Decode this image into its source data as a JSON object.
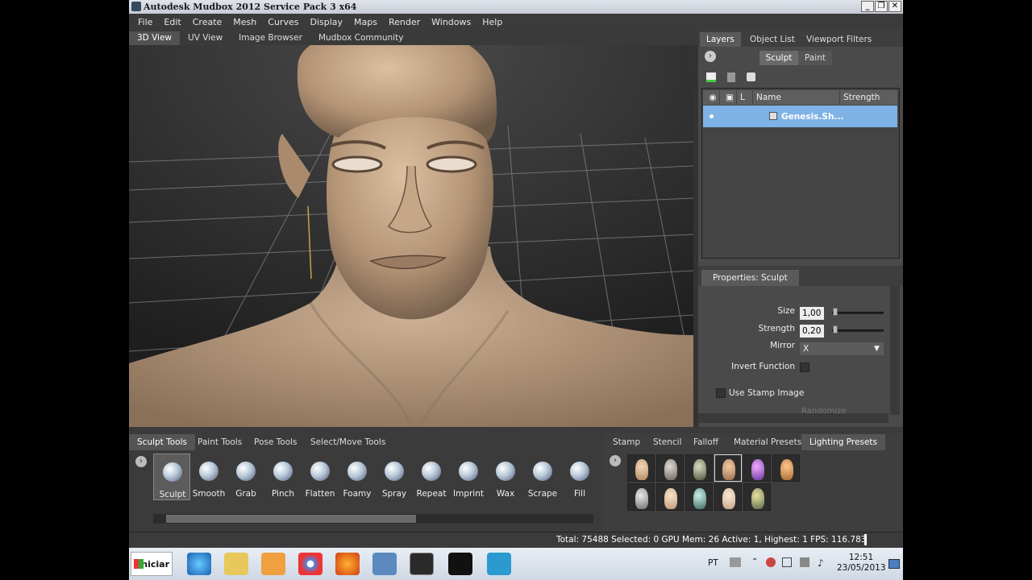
{
  "window": {
    "title": "Autodesk Mudbox 2012 Service Pack 3 x64",
    "min": "_",
    "max": "❐",
    "close": "✕"
  },
  "menu": [
    "File",
    "Edit",
    "Create",
    "Mesh",
    "Curves",
    "Display",
    "Maps",
    "Render",
    "Windows",
    "Help"
  ],
  "viewport_tabs": [
    "3D View",
    "UV View",
    "Image Browser",
    "Mudbox Community"
  ],
  "right_tabs": [
    "Layers",
    "Object List",
    "Viewport Filters"
  ],
  "layers": {
    "mode_sculpt": "Sculpt",
    "mode_paint": "Paint",
    "col_l": "L",
    "col_name": "Name",
    "col_strength": "Strength",
    "row_name": "Genesis.Sh..."
  },
  "properties": {
    "tab": "Properties: Sculpt",
    "size_label": "Size",
    "size_value": "1,00",
    "strength_label": "Strength",
    "strength_value": "0,20",
    "mirror_label": "Mirror",
    "mirror_value": "X",
    "invert_label": "Invert Function",
    "stamp_label": "Use Stamp Image",
    "randomize_label": "Randomize"
  },
  "tool_tabs": [
    "Sculpt Tools",
    "Paint Tools",
    "Pose Tools",
    "Select/Move Tools"
  ],
  "tools": [
    "Sculpt",
    "Smooth",
    "Grab",
    "Pinch",
    "Flatten",
    "Foamy",
    "Spray",
    "Repeat",
    "Imprint",
    "Wax",
    "Scrape",
    "Fill"
  ],
  "preset_tabs": [
    "Stamp",
    "Stencil",
    "Falloff",
    "Material Presets",
    "Lighting Presets"
  ],
  "status": "Total: 75488  Selected: 0 GPU Mem: 26  Active: 1, Highest: 1  FPS: 116.783",
  "taskbar": {
    "start": "Iniciar",
    "lang": "PT",
    "time": "12:51",
    "date": "23/05/2013"
  },
  "colors": {
    "selected_row": "#7fb2e5",
    "skin": "#c9ab8c"
  }
}
